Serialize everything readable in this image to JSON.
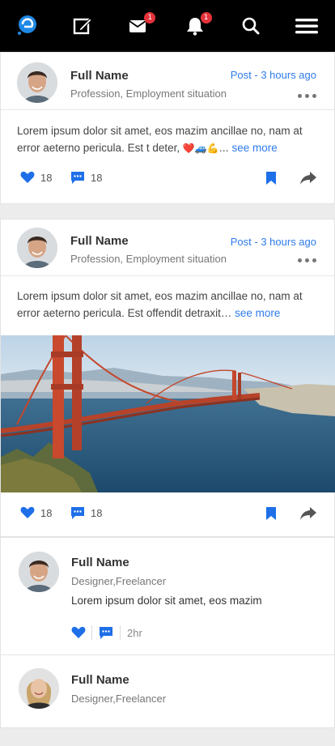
{
  "topbar": {
    "icons": [
      "app-logo-icon",
      "edit-icon",
      "mail-icon",
      "bell-icon",
      "search-icon",
      "menu-icon"
    ],
    "mail_badge": "1",
    "bell_badge": "1"
  },
  "posts": [
    {
      "name": "Full Name",
      "subtitle": "Profession, Employment situation",
      "time": "Post - 3 hours ago",
      "text": "Lorem ipsum dolor sit amet, eos mazim ancillae no, nam at error aeterno pericula. Est t deter,",
      "emoji": "❤️🚙💪…",
      "see_more": "see more",
      "likes": "18",
      "comments": "18"
    },
    {
      "name": "Full Name",
      "subtitle": "Profession, Employment situation",
      "time": "Post - 3 hours ago",
      "text": "Lorem ipsum dolor sit amet, eos mazim ancillae no, nam at error aeterno pericula. Est offendit detraxit…",
      "see_more": "see more",
      "likes": "18",
      "comments": "18"
    }
  ],
  "comments": [
    {
      "name": "Full Name",
      "subtitle": "Designer,Freelancer",
      "text": "Lorem ipsum dolor sit amet, eos mazim",
      "time": "2hr"
    },
    {
      "name": "Full Name",
      "subtitle": "Designer,Freelancer"
    }
  ],
  "colors": {
    "accent": "#2f7bea",
    "topbar": "#000000",
    "badge": "#e4333b"
  }
}
